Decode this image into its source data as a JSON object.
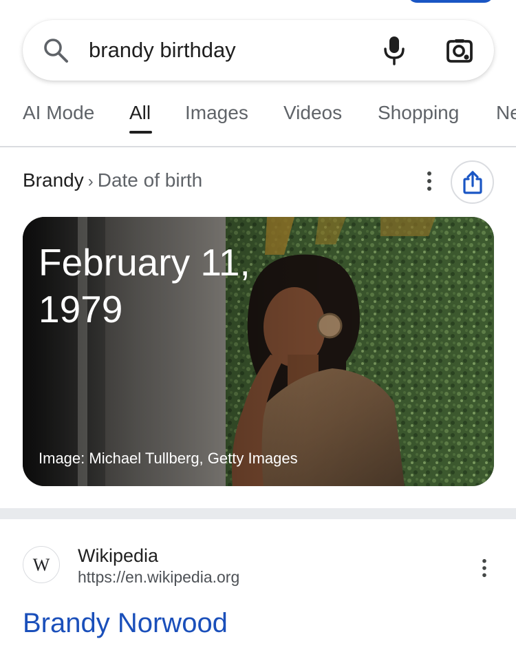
{
  "search": {
    "query": "brandy birthday"
  },
  "tabs": [
    {
      "label": "AI Mode",
      "active": false
    },
    {
      "label": "All",
      "active": true
    },
    {
      "label": "Images",
      "active": false
    },
    {
      "label": "Videos",
      "active": false
    },
    {
      "label": "Shopping",
      "active": false
    },
    {
      "label": "Ne",
      "active": false
    }
  ],
  "answer": {
    "entity": "Brandy",
    "separator": "›",
    "attribute": "Date of birth",
    "date": "February 11, 1979",
    "image_credit": "Image: Michael Tullberg, Getty Images"
  },
  "result": {
    "logo_letter": "W",
    "source_name": "Wikipedia",
    "source_url": "https://en.wikipedia.org",
    "title": "Brandy Norwood"
  },
  "colors": {
    "link_blue": "#1a4fba",
    "accent_blue": "#1a56c4",
    "tab_gray": "#5f6368"
  },
  "icons": [
    "search-icon",
    "microphone-icon",
    "google-lens-icon",
    "more-vert-icon",
    "share-icon",
    "wikipedia-logo"
  ]
}
